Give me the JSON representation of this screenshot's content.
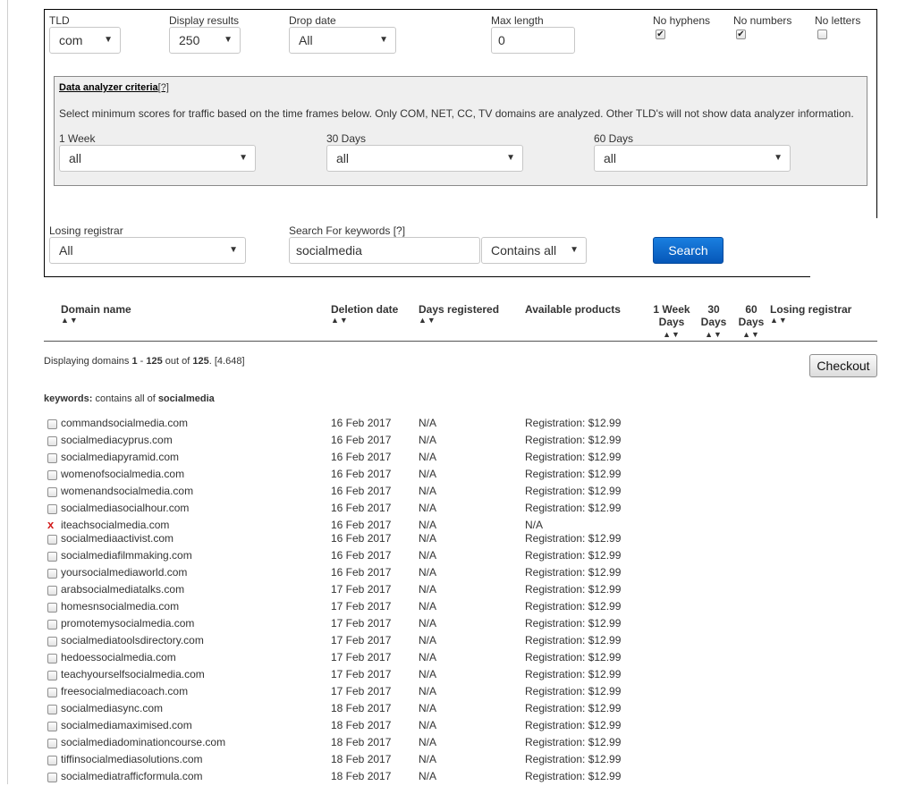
{
  "filters": {
    "tld": {
      "label": "TLD",
      "value": "com"
    },
    "display_results": {
      "label": "Display results",
      "value": "250"
    },
    "drop_date": {
      "label": "Drop date",
      "value": "All"
    },
    "max_length": {
      "label": "Max length",
      "value": "0"
    },
    "no_hyphens": {
      "label": "No hyphens",
      "checked": true
    },
    "no_numbers": {
      "label": "No numbers",
      "checked": true
    },
    "no_letters": {
      "label": "No letters",
      "checked": false
    }
  },
  "analyzer": {
    "title": "Data analyzer criteria",
    "help": "[?]",
    "description": "Select minimum scores for traffic based on the time frames below. Only COM, NET, CC, TV domains are analyzed. Other TLD's will not show data analyzer information.",
    "one_week": {
      "label": "1 Week",
      "value": "all"
    },
    "thirty_days": {
      "label": "30 Days",
      "value": "all"
    },
    "sixty_days": {
      "label": "60 Days",
      "value": "all"
    }
  },
  "losing_registrar": {
    "label": "Losing registrar",
    "value": "All"
  },
  "keywords": {
    "label": "Search For keywords [?]",
    "value": "socialmedia",
    "mode": "Contains all"
  },
  "search_button": "Search",
  "columns": {
    "domain": "Domain name",
    "deletion": "Deletion date",
    "days_registered": "Days registered",
    "products": "Available products",
    "week_1": "1 Week",
    "week_2": "Days",
    "d30_1": "30",
    "d30_2": "Days",
    "d60_1": "60",
    "d60_2": "Days",
    "losing": "Losing registrar",
    "sort": "▲▼"
  },
  "summary": {
    "prefix": "Displaying domains",
    "from": "1",
    "dash": "-",
    "to": "125",
    "out_of": "out of",
    "total": "125",
    "time": "[4.648]"
  },
  "keyword_line": {
    "prefix": "keywords:",
    "text": "contains all of",
    "keyword": "socialmedia"
  },
  "checkout_button": "Checkout",
  "unavailable_mark": "x",
  "rows": [
    {
      "domain": "commandsocialmedia.com",
      "date": "16 Feb 2017",
      "days": "N/A",
      "product": "Registration: $12.99",
      "available": true
    },
    {
      "domain": "socialmediacyprus.com",
      "date": "16 Feb 2017",
      "days": "N/A",
      "product": "Registration: $12.99",
      "available": true
    },
    {
      "domain": "socialmediapyramid.com",
      "date": "16 Feb 2017",
      "days": "N/A",
      "product": "Registration: $12.99",
      "available": true
    },
    {
      "domain": "womenofsocialmedia.com",
      "date": "16 Feb 2017",
      "days": "N/A",
      "product": "Registration: $12.99",
      "available": true
    },
    {
      "domain": "womenandsocialmedia.com",
      "date": "16 Feb 2017",
      "days": "N/A",
      "product": "Registration: $12.99",
      "available": true
    },
    {
      "domain": "socialmediasocialhour.com",
      "date": "16 Feb 2017",
      "days": "N/A",
      "product": "Registration: $12.99",
      "available": true
    },
    {
      "domain": "iteachsocialmedia.com",
      "date": "16 Feb 2017",
      "days": "N/A",
      "product": "N/A",
      "available": false
    },
    {
      "domain": "socialmediaactivist.com",
      "date": "16 Feb 2017",
      "days": "N/A",
      "product": "Registration: $12.99",
      "available": true
    },
    {
      "domain": "socialmediafilmmaking.com",
      "date": "16 Feb 2017",
      "days": "N/A",
      "product": "Registration: $12.99",
      "available": true
    },
    {
      "domain": "yoursocialmediaworld.com",
      "date": "16 Feb 2017",
      "days": "N/A",
      "product": "Registration: $12.99",
      "available": true
    },
    {
      "domain": "arabsocialmediatalks.com",
      "date": "17 Feb 2017",
      "days": "N/A",
      "product": "Registration: $12.99",
      "available": true
    },
    {
      "domain": "homesnsocialmedia.com",
      "date": "17 Feb 2017",
      "days": "N/A",
      "product": "Registration: $12.99",
      "available": true
    },
    {
      "domain": "promotemysocialmedia.com",
      "date": "17 Feb 2017",
      "days": "N/A",
      "product": "Registration: $12.99",
      "available": true
    },
    {
      "domain": "socialmediatoolsdirectory.com",
      "date": "17 Feb 2017",
      "days": "N/A",
      "product": "Registration: $12.99",
      "available": true
    },
    {
      "domain": "hedoessocialmedia.com",
      "date": "17 Feb 2017",
      "days": "N/A",
      "product": "Registration: $12.99",
      "available": true
    },
    {
      "domain": "teachyourselfsocialmedia.com",
      "date": "17 Feb 2017",
      "days": "N/A",
      "product": "Registration: $12.99",
      "available": true
    },
    {
      "domain": "freesocialmediacoach.com",
      "date": "17 Feb 2017",
      "days": "N/A",
      "product": "Registration: $12.99",
      "available": true
    },
    {
      "domain": "socialmediasync.com",
      "date": "18 Feb 2017",
      "days": "N/A",
      "product": "Registration: $12.99",
      "available": true
    },
    {
      "domain": "socialmediamaximised.com",
      "date": "18 Feb 2017",
      "days": "N/A",
      "product": "Registration: $12.99",
      "available": true
    },
    {
      "domain": "socialmediadominationcourse.com",
      "date": "18 Feb 2017",
      "days": "N/A",
      "product": "Registration: $12.99",
      "available": true
    },
    {
      "domain": "tiffinsocialmediasolutions.com",
      "date": "18 Feb 2017",
      "days": "N/A",
      "product": "Registration: $12.99",
      "available": true
    },
    {
      "domain": "socialmediatrafficformula.com",
      "date": "18 Feb 2017",
      "days": "N/A",
      "product": "Registration: $12.99",
      "available": true
    }
  ]
}
